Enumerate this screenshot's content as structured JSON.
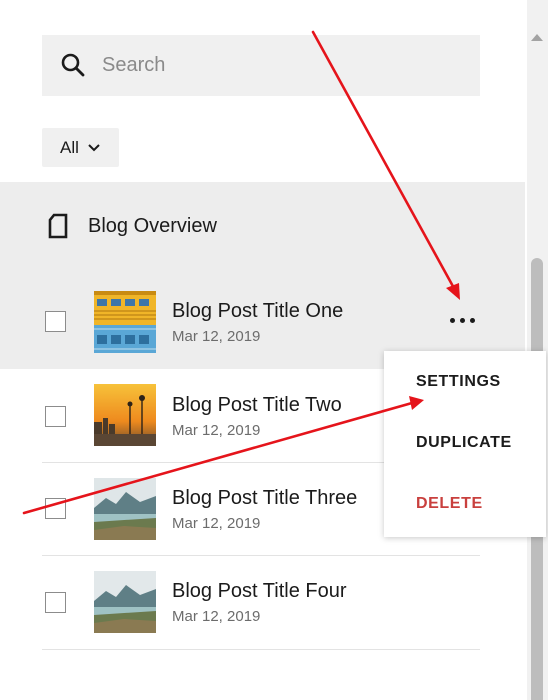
{
  "search": {
    "placeholder": "Search"
  },
  "filter": {
    "label": "All"
  },
  "overview": {
    "label": "Blog Overview"
  },
  "posts": [
    {
      "title": "Blog Post Title One",
      "date": "Mar 12, 2019"
    },
    {
      "title": "Blog Post Title Two",
      "date": "Mar 12, 2019"
    },
    {
      "title": "Blog Post Title Three",
      "date": "Mar 12, 2019"
    },
    {
      "title": "Blog Post Title Four",
      "date": "Mar 12, 2019"
    }
  ],
  "context_menu": {
    "settings": "SETTINGS",
    "duplicate": "DUPLICATE",
    "delete": "DELETE"
  },
  "icons": {
    "search": "search-icon",
    "filter": "chevron-down-icon",
    "overview": "document-icon",
    "more": "more-options-icon"
  },
  "colors": {
    "annotation_arrow": "#e5141b",
    "delete": "#c9403e",
    "selected_row": "#ededed"
  }
}
